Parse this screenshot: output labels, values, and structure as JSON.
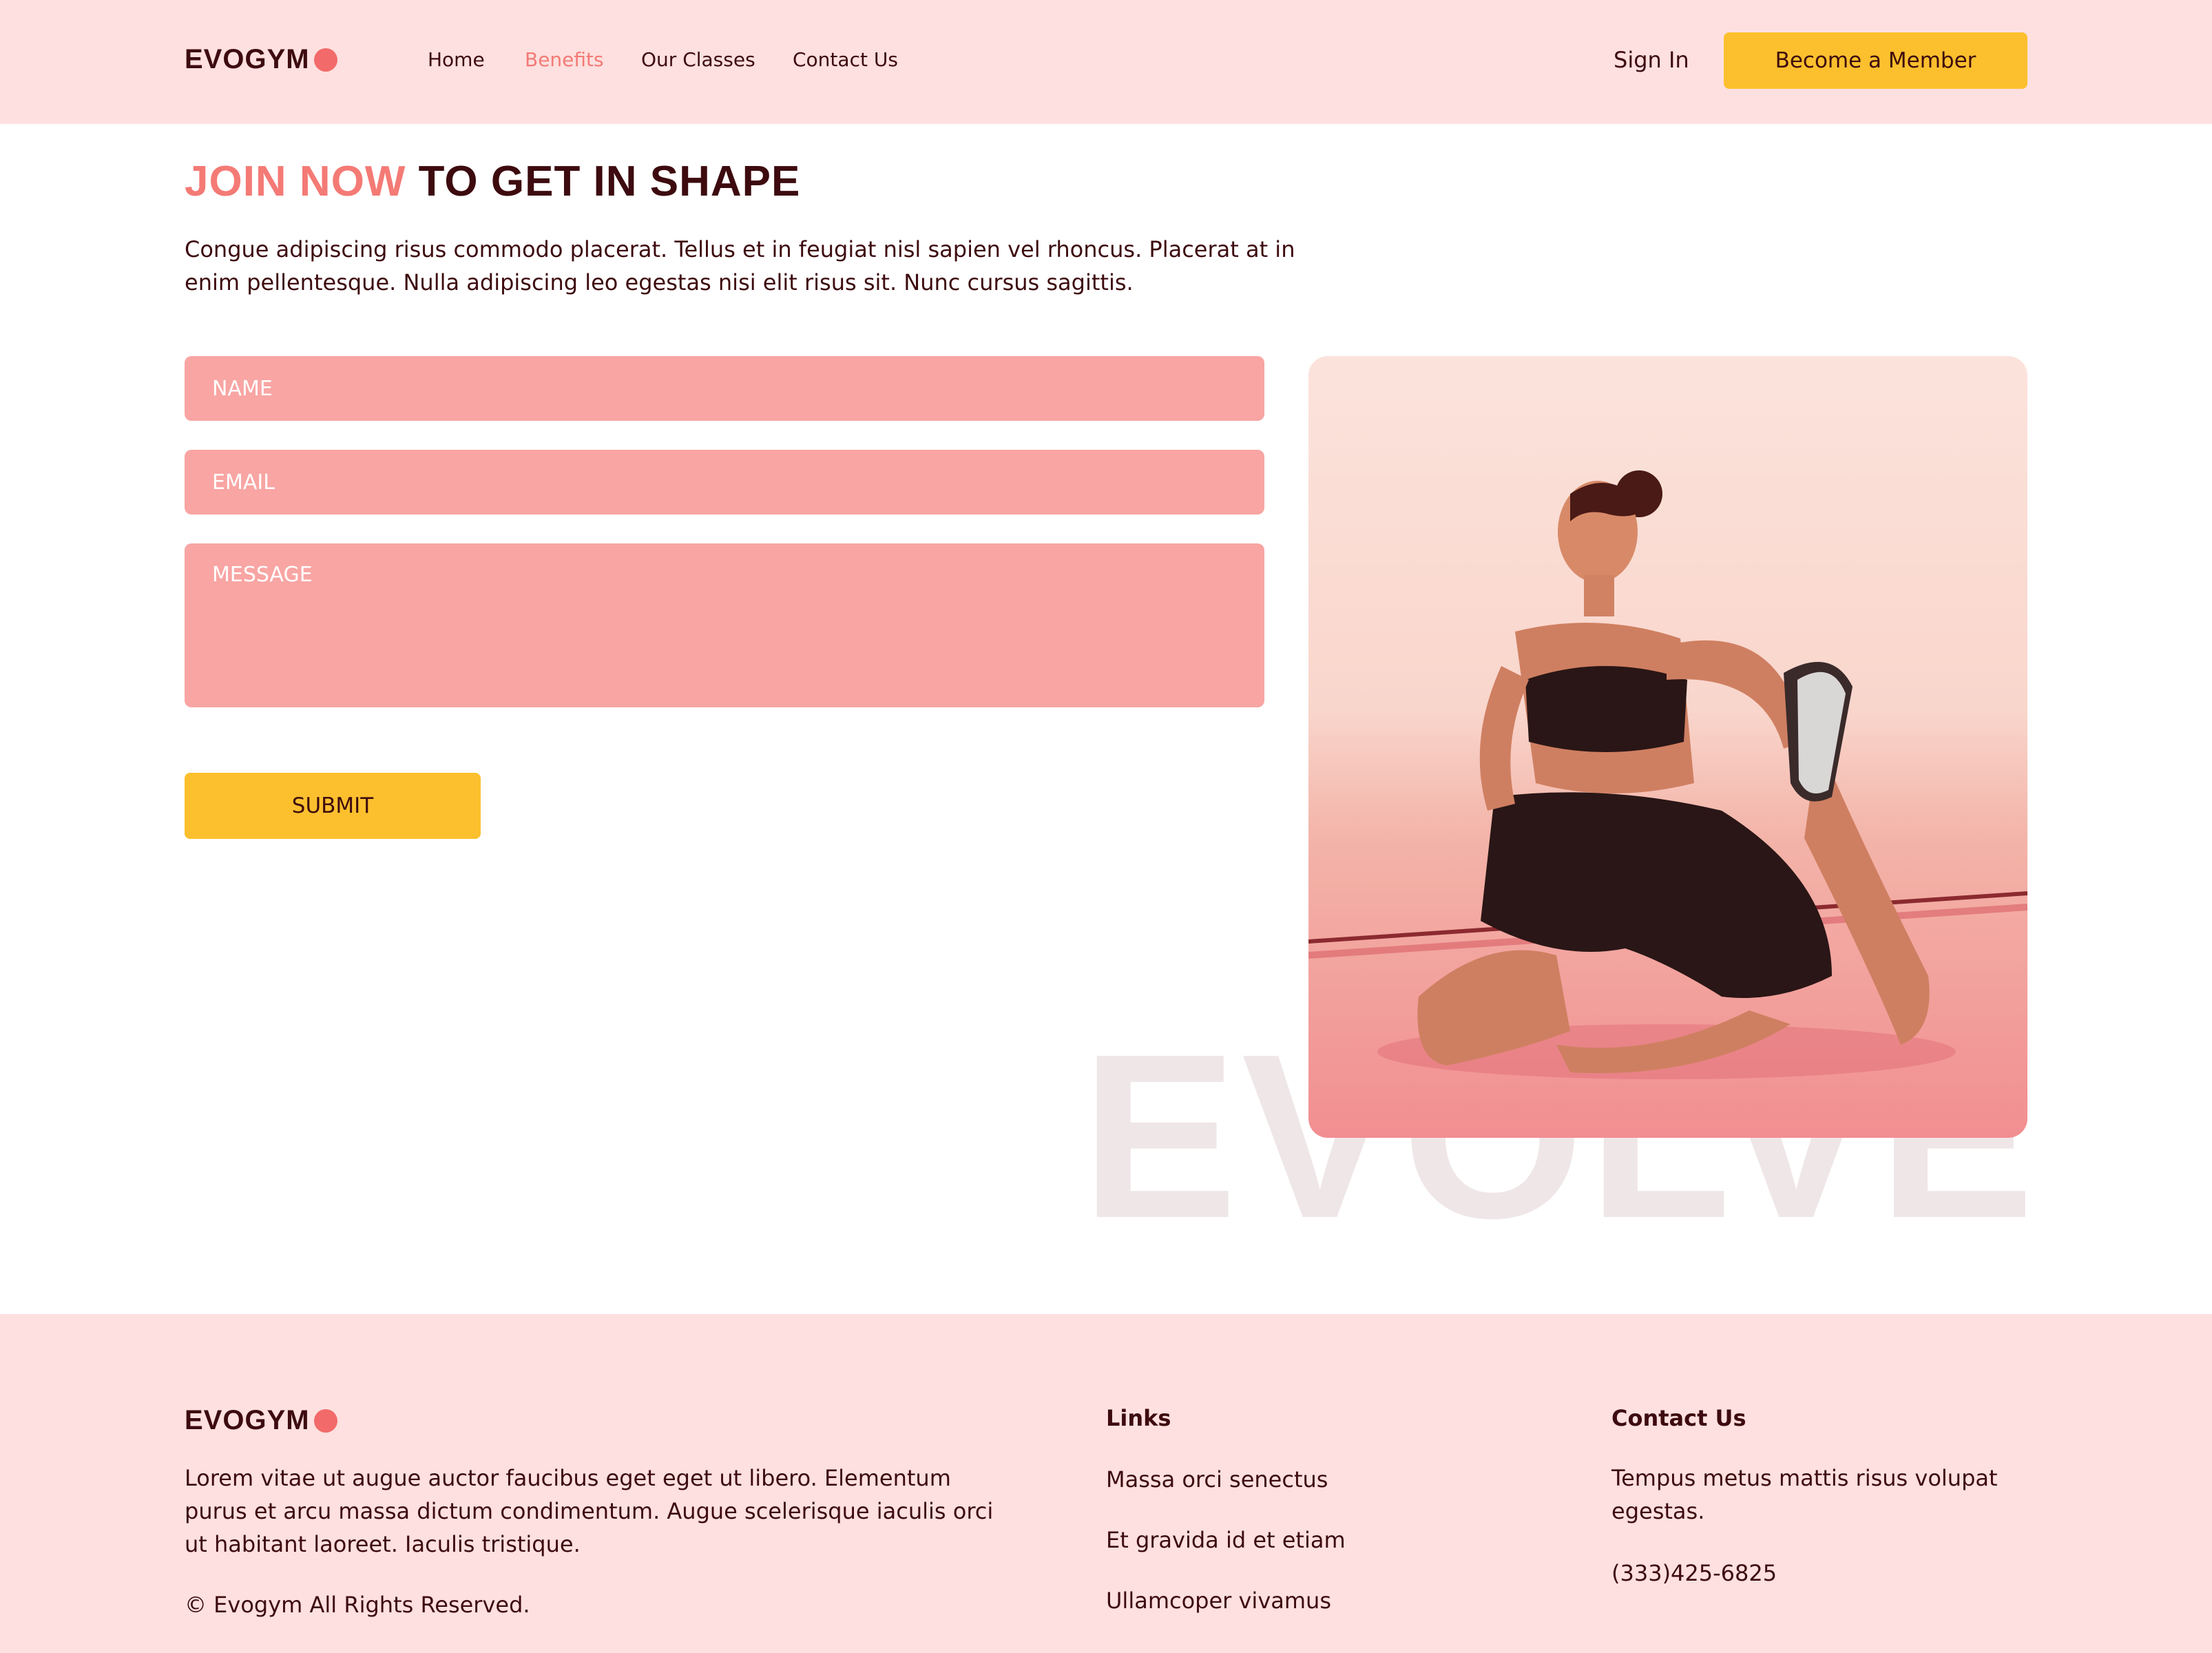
{
  "brand": {
    "name": "EVOGYM",
    "accent": "#f47a75",
    "primary": "#fcc02e",
    "background": "#fde0df"
  },
  "nav": {
    "links": [
      "Home",
      "Benefits",
      "Our Classes",
      "Contact Us"
    ],
    "active": "Benefits",
    "sign_in": "Sign In",
    "cta": "Become a Member"
  },
  "hero": {
    "heading_highlight": "JOIN NOW",
    "heading_rest": " TO GET IN SHAPE",
    "description": "Congue adipiscing risus commodo placerat. Tellus et in feugiat nisl sapien vel rhoncus. Placerat at in enim pellentesque. Nulla adipiscing leo egestas nisi elit risus sit. Nunc cursus sagittis."
  },
  "form": {
    "name_placeholder": "NAME",
    "email_placeholder": "EMAIL",
    "message_placeholder": "MESSAGE",
    "submit_label": "SUBMIT"
  },
  "watermark": "EVOLVE",
  "footer": {
    "description": "Lorem vitae ut augue auctor faucibus eget eget ut libero. Elementum purus et arcu massa dictum condimentum. Augue scelerisque iaculis orci ut habitant laoreet. Iaculis tristique.",
    "copyright": "© Evogym All Rights Reserved.",
    "links_title": "Links",
    "links": [
      "Massa orci senectus",
      "Et gravida id et etiam",
      "Ullamcoper vivamus"
    ],
    "contact_title": "Contact Us",
    "contact_text": "Tempus metus mattis risus volupat egestas.",
    "phone": "(333)425-6825"
  }
}
